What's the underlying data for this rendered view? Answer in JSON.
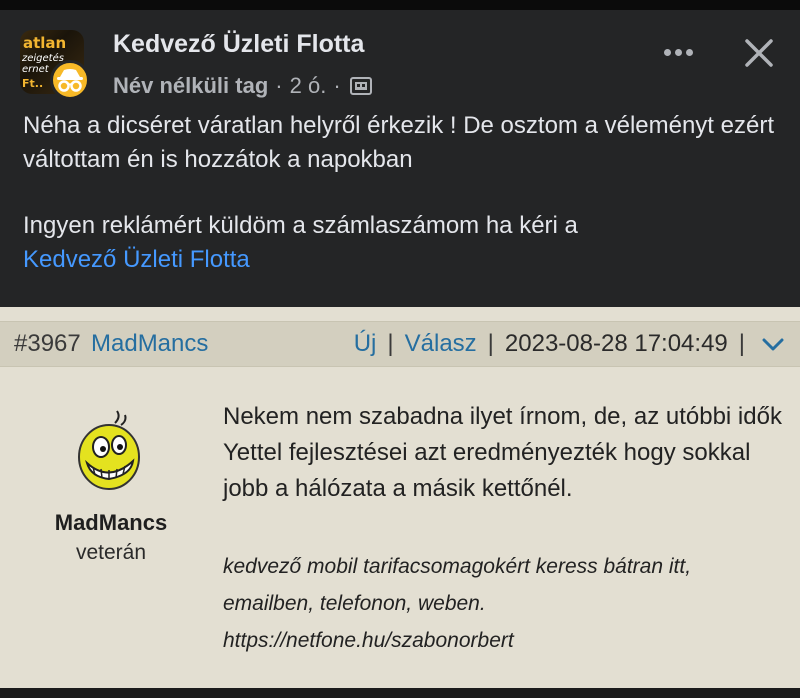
{
  "post": {
    "group_name": "Kedvező Üzleti Flotta",
    "member_label": "Név nélküli tag",
    "time_ago": "2 ó.",
    "separator": "·",
    "avatar_text": {
      "line1": "atlan",
      "line2": "zeigetés",
      "line3": "ernet",
      "line4": "Ft.."
    },
    "text_line1": "Néha a dicséret váratlan helyről érkezik ! De osztom a véleményt ezért váltottam én is hozzátok a napokban",
    "text_line2": "Ingyen reklámért küldöm a számlaszámom ha kéri a",
    "link_text": "Kedvező Üzleti Flotta",
    "icons": {
      "more": "more-dots-icon",
      "close": "close-icon",
      "audience": "group-audience-icon",
      "anonymous": "anonymous-member-icon"
    }
  },
  "forum": {
    "post_number": "#3967",
    "username": "MadMancs",
    "new_label": "Új",
    "reply_label": "Válasz",
    "pipe": "|",
    "datetime": "2023-08-28 17:04:49",
    "author_name": "MadMancs",
    "author_rank": "veterán",
    "body": "Nekem nem szabadna ilyet írnom, de, az utóbbi idők Yettel fejlesztései azt eredményezték hogy sokkal jobb a hálózata a másik kettőnél.",
    "signature": [
      "kedvező mobil tarifacsomagokért keress bátran itt,",
      "emailben, telefonon, weben.",
      "https://netfone.hu/szabonorbert"
    ],
    "icons": {
      "chevron": "chevron-down-icon",
      "avatar": "smiley-avatar-icon"
    }
  },
  "colors": {
    "fb_bg": "#242526",
    "fb_text": "#e4e6eb",
    "fb_link": "#4599ff",
    "forum_bg": "#e3dfd2",
    "forum_header_bg": "#d3cfbf",
    "forum_link": "#256ea0"
  }
}
